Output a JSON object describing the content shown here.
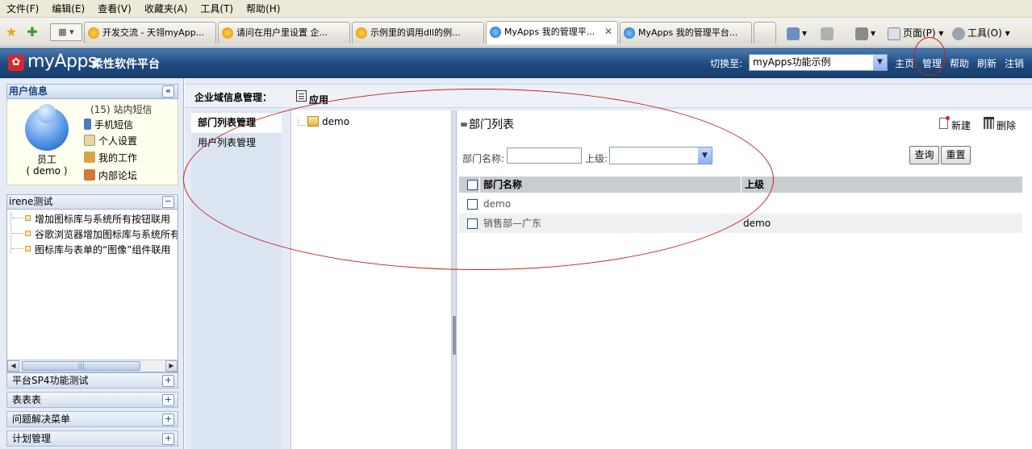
{
  "browser": {
    "menu": [
      "文件(F)",
      "编辑(E)",
      "查看(V)",
      "收藏夹(A)",
      "工具(T)",
      "帮助(H)"
    ],
    "tabs": [
      {
        "label": "开发交流 - 天翎myApp..."
      },
      {
        "label": "请问在用户里设置 企..."
      },
      {
        "label": "示例里的调用dll的例..."
      },
      {
        "label": "MyApps 我的管理平...",
        "close": "✕"
      },
      {
        "label": "MyApps 我的管理平台..."
      }
    ],
    "toolbar": {
      "page_label": "页面(P)",
      "tools_label": "工具(O)"
    }
  },
  "header": {
    "logo_icon": "✿",
    "logo_text": "myApps",
    "logo_sub": "柔性软件平台",
    "switch_label": "切换至:",
    "app_selected": "myApps功能示例",
    "links": [
      "主页",
      "管理",
      "帮助",
      "刷新",
      "注销"
    ]
  },
  "sidebar": {
    "userinfo_title": "用户信息",
    "collapse_label": "«",
    "user_name": "员工",
    "user_id": "( demo )",
    "msg_count": "(15) 站内短信",
    "links": [
      "手机短信",
      "个人设置",
      "我的工作",
      "内部论坛"
    ],
    "menu_title": "irene测试",
    "menu_toggle": "−",
    "menu_items": [
      "增加图标库与系统所有按钮联用",
      "谷歌浏览器增加图标库与系统所有",
      "图标库与表单的“图像”组件联用"
    ],
    "scroll_grip": "|||",
    "accordions": [
      "平台SP4功能测试",
      "表表表",
      "问题解决菜单",
      "计划管理"
    ],
    "accordion_toggle": "+"
  },
  "main": {
    "domain_title": "企业域信息管理：",
    "app_tab": "应用",
    "nav": [
      "部门列表管理",
      "用户列表管理"
    ],
    "tree_root": "demo",
    "grid_title": "部门列表",
    "btn_new": "新建",
    "btn_delete": "删除",
    "filter": {
      "dept_label": "部门名称:",
      "parent_label": "上级:",
      "query": "查询",
      "reset": "重置"
    },
    "columns": [
      "部门名称",
      "上级"
    ],
    "rows": [
      {
        "name": "demo",
        "parent": ""
      },
      {
        "name": "销售部—广东",
        "parent": "demo"
      }
    ]
  },
  "colors": {
    "header_blue": "#1f4a7f",
    "annotation_red": "#c62020",
    "sidebar_bg": "#e5ecf6"
  }
}
